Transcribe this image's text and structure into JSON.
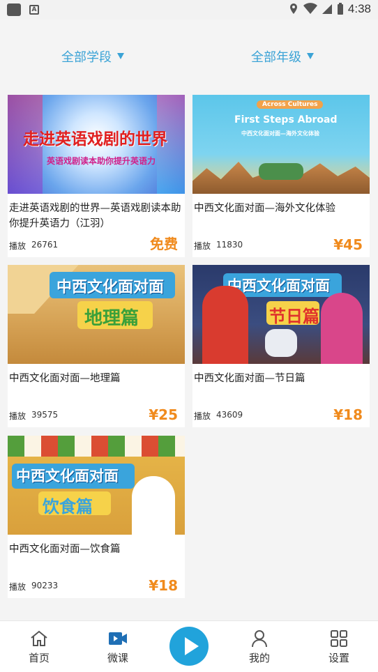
{
  "status_bar": {
    "time": "4:38"
  },
  "filters": [
    {
      "label": "全部学段"
    },
    {
      "label": "全部年级"
    }
  ],
  "courses": [
    {
      "title": "走进英语戏剧的世界—英语戏剧读本助你提升英语力（江羽）",
      "plays_label": "播放",
      "plays": "26761",
      "price": "免费",
      "thumb_title": "走进英语戏剧的世界",
      "thumb_subtitle": "英语戏剧读本助你提升英语力"
    },
    {
      "title": "中西文化面对面—海外文化体验",
      "plays_label": "播放",
      "plays": "11830",
      "price": "¥45",
      "thumb_title": "First Steps Abroad",
      "thumb_subtitle": "中西文化面对面—海外文化体验",
      "thumb_tag": "Across Cultures"
    },
    {
      "title": "中西文化面对面—地理篇",
      "plays_label": "播放",
      "plays": "39575",
      "price": "¥25",
      "thumb_title": "中西文化面对面",
      "thumb_subtitle": "地理篇"
    },
    {
      "title": "中西文化面对面—节日篇",
      "plays_label": "播放",
      "plays": "43609",
      "price": "¥18",
      "thumb_title": "中西文化面对面",
      "thumb_subtitle": "节日篇"
    },
    {
      "title": "中西文化面对面—饮食篇",
      "plays_label": "播放",
      "plays": "90233",
      "price": "¥18",
      "thumb_title": "中西文化面对面",
      "thumb_subtitle": "饮食篇"
    }
  ],
  "nav": {
    "home": "首页",
    "micro": "微课",
    "mine": "我的",
    "settings": "设置"
  },
  "colors": {
    "accent": "#21a3db",
    "filter": "#3ba3d6",
    "price": "#f08a1c"
  }
}
